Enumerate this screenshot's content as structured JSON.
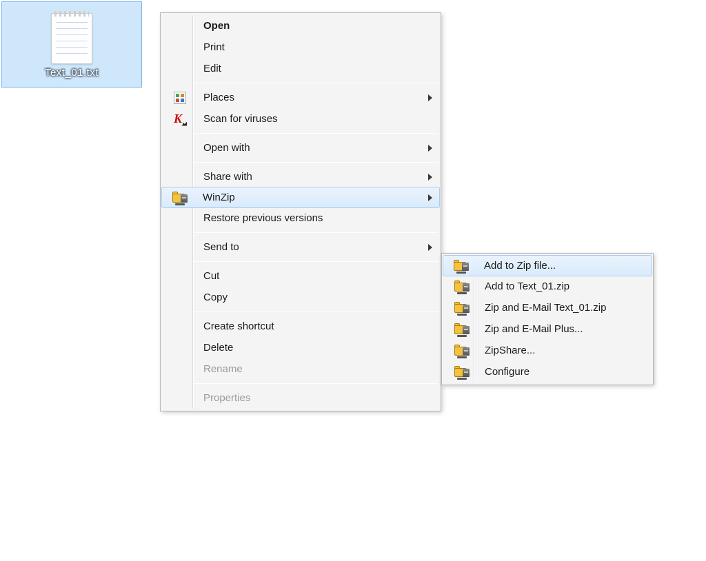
{
  "file": {
    "name": "Text_01.txt"
  },
  "context_menu": {
    "open": "Open",
    "print": "Print",
    "edit": "Edit",
    "places": "Places",
    "scan_viruses": "Scan for viruses",
    "open_with": "Open with",
    "share_with": "Share with",
    "winzip": "WinZip",
    "restore_versions": "Restore previous versions",
    "send_to": "Send to",
    "cut": "Cut",
    "copy": "Copy",
    "create_shortcut": "Create shortcut",
    "delete": "Delete",
    "rename": "Rename",
    "properties": "Properties"
  },
  "winzip_submenu": {
    "add_zip": "Add to Zip file...",
    "add_named": "Add to Text_01.zip",
    "zip_email": "Zip and E-Mail Text_01.zip",
    "zip_email_plus": "Zip and E-Mail Plus...",
    "zipshare": "ZipShare...",
    "configure": "Configure"
  }
}
